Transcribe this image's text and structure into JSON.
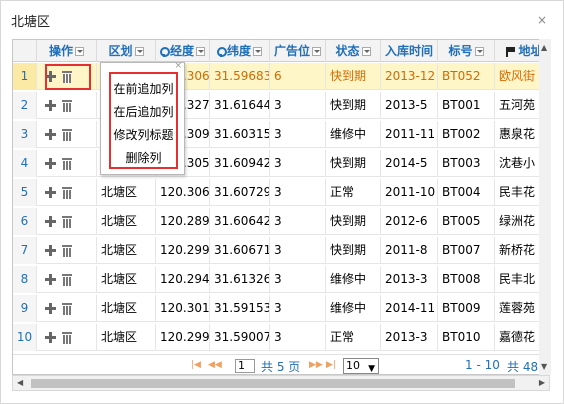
{
  "window": {
    "title": "北塘区",
    "close_glyph": "×"
  },
  "columns": [
    {
      "key": "ops",
      "label": "操作",
      "filter": true
    },
    {
      "key": "district",
      "label": "区划",
      "filter": true
    },
    {
      "key": "lng",
      "label": "经度",
      "filter": true,
      "icon": "pin-icon"
    },
    {
      "key": "lat",
      "label": "纬度",
      "filter": true,
      "icon": "pin-icon"
    },
    {
      "key": "ad",
      "label": "广告位",
      "filter": true
    },
    {
      "key": "status",
      "label": "状态",
      "filter": true
    },
    {
      "key": "date",
      "label": "入库时间",
      "filter": false
    },
    {
      "key": "code",
      "label": "标号",
      "filter": true
    },
    {
      "key": "addr",
      "label": "地址",
      "filter": false,
      "icon": "flag-icon"
    }
  ],
  "rows": [
    {
      "n": "1",
      "district": "北塘区",
      "lng": "120.30632",
      "lat": "31.596835",
      "ad": "6",
      "status": "快到期",
      "date": "2013-12",
      "code": "BT052",
      "addr": "欧风街",
      "selected": true
    },
    {
      "n": "2",
      "district": "北塘区",
      "lng": "120.32765",
      "lat": "31.616443",
      "ad": "3",
      "status": "快到期",
      "date": "2013-5",
      "code": "BT001",
      "addr": "五河苑",
      "selected": false
    },
    {
      "n": "3",
      "district": "北塘区",
      "lng": "120.30915",
      "lat": "31.603156",
      "ad": "3",
      "status": "维修中",
      "date": "2011-11",
      "code": "BT002",
      "addr": "惠泉花",
      "selected": false
    },
    {
      "n": "4",
      "district": "北塘区",
      "lng": "120.30533",
      "lat": "31.609424",
      "ad": "3",
      "status": "快到期",
      "date": "2014-5",
      "code": "BT003",
      "addr": "沈巷小",
      "selected": false
    },
    {
      "n": "5",
      "district": "北塘区",
      "lng": "120.30616",
      "lat": "31.607295",
      "ad": "3",
      "status": "正常",
      "date": "2011-10",
      "code": "BT004",
      "addr": "民丰花",
      "selected": false
    },
    {
      "n": "6",
      "district": "北塘区",
      "lng": "120.28986",
      "lat": "31.60642",
      "ad": "3",
      "status": "快到期",
      "date": "2012-6",
      "code": "BT005",
      "addr": "绿洲花",
      "selected": false
    },
    {
      "n": "7",
      "district": "北塘区",
      "lng": "120.29928",
      "lat": "31.606712",
      "ad": "3",
      "status": "快到期",
      "date": "2011-8",
      "code": "BT007",
      "addr": "新桥花",
      "selected": false
    },
    {
      "n": "8",
      "district": "北塘区",
      "lng": "120.29481",
      "lat": "31.613261",
      "ad": "3",
      "status": "维修中",
      "date": "2013-3",
      "code": "BT008",
      "addr": "民丰北",
      "selected": false
    },
    {
      "n": "9",
      "district": "北塘区",
      "lng": "120.30140",
      "lat": "31.591532",
      "ad": "3",
      "status": "维修中",
      "date": "2014-11",
      "code": "BT009",
      "addr": "莲蓉苑",
      "selected": false
    },
    {
      "n": "10",
      "district": "北塘区",
      "lng": "120.29975",
      "lat": "31.590073",
      "ad": "3",
      "status": "正常",
      "date": "2013-3",
      "code": "BT010",
      "addr": "嘉德花",
      "selected": false
    }
  ],
  "context_menu": {
    "items": [
      "在前追加列",
      "在后追加列",
      "修改列标题",
      "删除列"
    ],
    "close_glyph": "×"
  },
  "pager": {
    "first": "|◀",
    "prev": "◀◀",
    "page_value": "1",
    "total_pages": "共 5 页",
    "next": "▶▶",
    "last": "▶|",
    "page_size": "10",
    "range_text": "1 - 10",
    "total_text": "共 48"
  },
  "colors": {
    "accent": "#1f6fb9",
    "selected_bg": "#fff6c8",
    "selected_text": "#d36a00",
    "highlight": "#e53030"
  }
}
